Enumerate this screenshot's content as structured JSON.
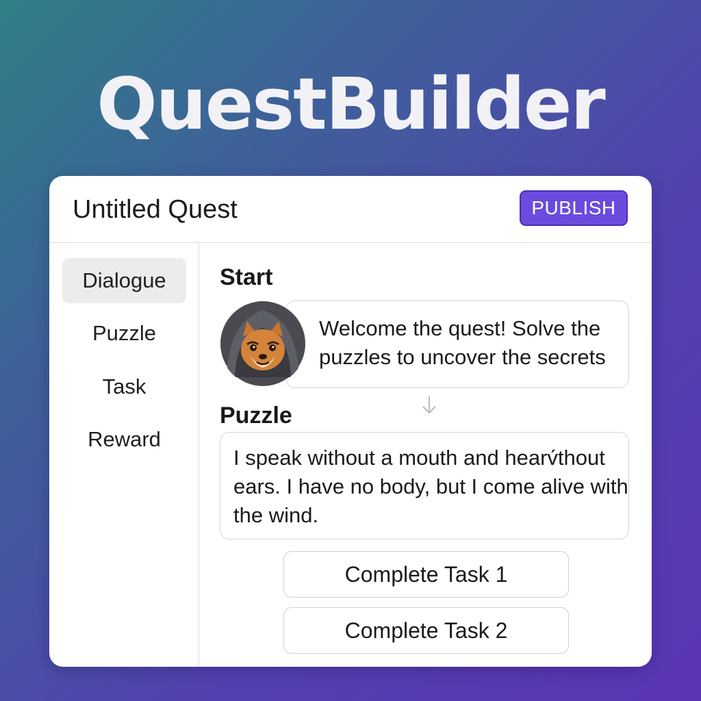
{
  "app": {
    "title": "QuestBuilder"
  },
  "header": {
    "quest_title": "Untitled Quest",
    "publish_label": "PUBLISH"
  },
  "sidebar": {
    "items": [
      {
        "label": "Dialogue",
        "active": true
      },
      {
        "label": "Puzzle",
        "active": false
      },
      {
        "label": "Task",
        "active": false
      },
      {
        "label": "Reward",
        "active": false
      }
    ]
  },
  "content": {
    "start": {
      "label": "Start",
      "dialogue": "Welcome the quest! Solve the puzzles to uncover the secrets",
      "avatar_icon": "hooded-fox-avatar"
    },
    "connector_icon": "arrow-down-icon",
    "puzzle": {
      "label": "Puzzle",
      "text": "I speak without a mouth and hearv́thout ears. I have no body, but I come alive with the wind."
    },
    "tasks": [
      {
        "label": "Complete Task 1"
      },
      {
        "label": "Complete Task 2"
      }
    ]
  },
  "colors": {
    "accent": "#6a4bde",
    "background_start": "#2f7f86",
    "background_end": "#5b35b4"
  }
}
